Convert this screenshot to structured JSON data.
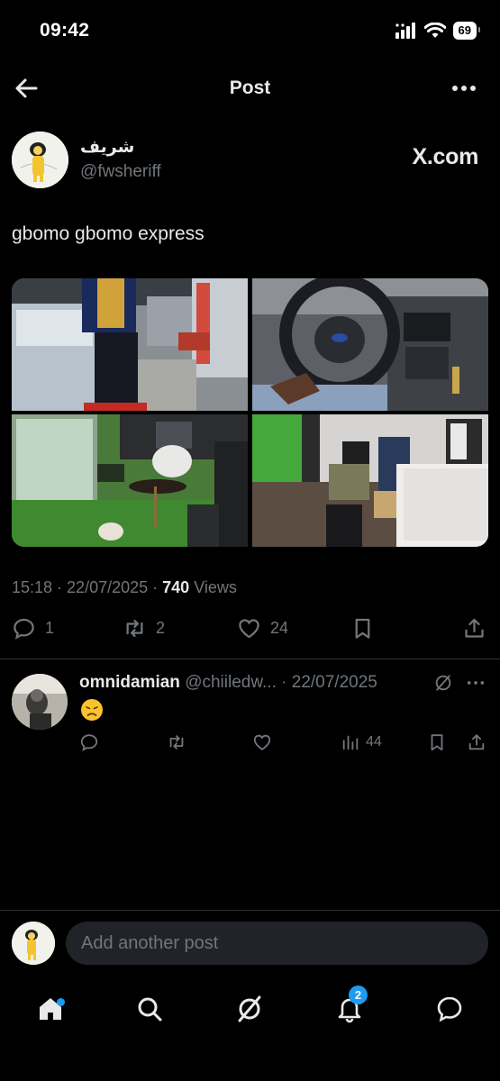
{
  "status_bar": {
    "time": "09:42",
    "battery": "69"
  },
  "header": {
    "title": "Post"
  },
  "post": {
    "display_name": "شريف",
    "handle": "@fwsheriff",
    "source_label": "X.com",
    "text": "gbomo gbomo express",
    "time": "15:18",
    "date": "22/07/2025",
    "views_count": "740",
    "views_label": "Views",
    "replies": "1",
    "reposts": "2",
    "likes": "24"
  },
  "reply": {
    "name": "omnidamian",
    "handle": "@chiiledw...",
    "date": "22/07/2025",
    "views": "44"
  },
  "composer": {
    "placeholder": "Add another post"
  },
  "tabbar": {
    "notifications_badge": "2"
  },
  "colors": {
    "accent": "#1d9bf0",
    "muted": "#71767b",
    "text": "#e7e9ea",
    "background": "#000000"
  }
}
